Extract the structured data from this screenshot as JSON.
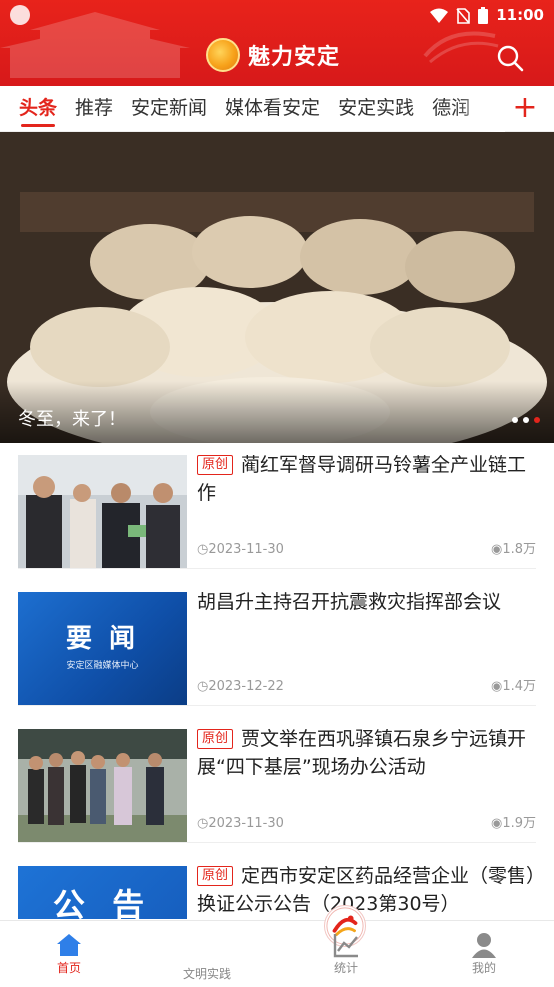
{
  "status_bar": {
    "time": "11:00"
  },
  "header": {
    "title": "魅力安定",
    "search_icon": "search-icon"
  },
  "tabs": [
    {
      "label": "头条",
      "active": true
    },
    {
      "label": "推荐"
    },
    {
      "label": "安定新闻"
    },
    {
      "label": "媒体看安定"
    },
    {
      "label": "安定实践"
    },
    {
      "label": "德润"
    }
  ],
  "add_tab_label": "+",
  "banner": {
    "title": "冬至，来了！",
    "slide_count": 3,
    "active_slide": 3
  },
  "news": [
    {
      "tag": "原创",
      "title": "蔺红军督导调研马铃薯全产业链工作",
      "date": "2023-11-30",
      "views": "1.8万"
    },
    {
      "tag": "",
      "title": "胡昌升主持召开抗震救灾指挥部会议",
      "date": "2023-12-22",
      "views": "1.4万",
      "thumb_text": "要 闻",
      "thumb_sub": "安定区融媒体中心"
    },
    {
      "tag": "原创",
      "title": "贾文举在西巩驿镇石泉乡宁远镇开展“四下基层”现场办公活动",
      "date": "2023-11-30",
      "views": "1.9万"
    },
    {
      "tag": "原创",
      "title": "定西市安定区药品经营企业（零售）换证公示公告（2023第30号）",
      "date": "",
      "views": "",
      "thumb_text": "公 告"
    }
  ],
  "tabbar": [
    {
      "label": "首页",
      "icon": "home-icon",
      "active": true
    },
    {
      "label": "文明实践",
      "icon": "civilization-logo-icon"
    },
    {
      "label": "统计",
      "icon": "chart-icon"
    },
    {
      "label": "我的",
      "icon": "user-icon"
    }
  ],
  "colors": {
    "brand_red": "#e3251c",
    "header_red": "#d7191a"
  }
}
